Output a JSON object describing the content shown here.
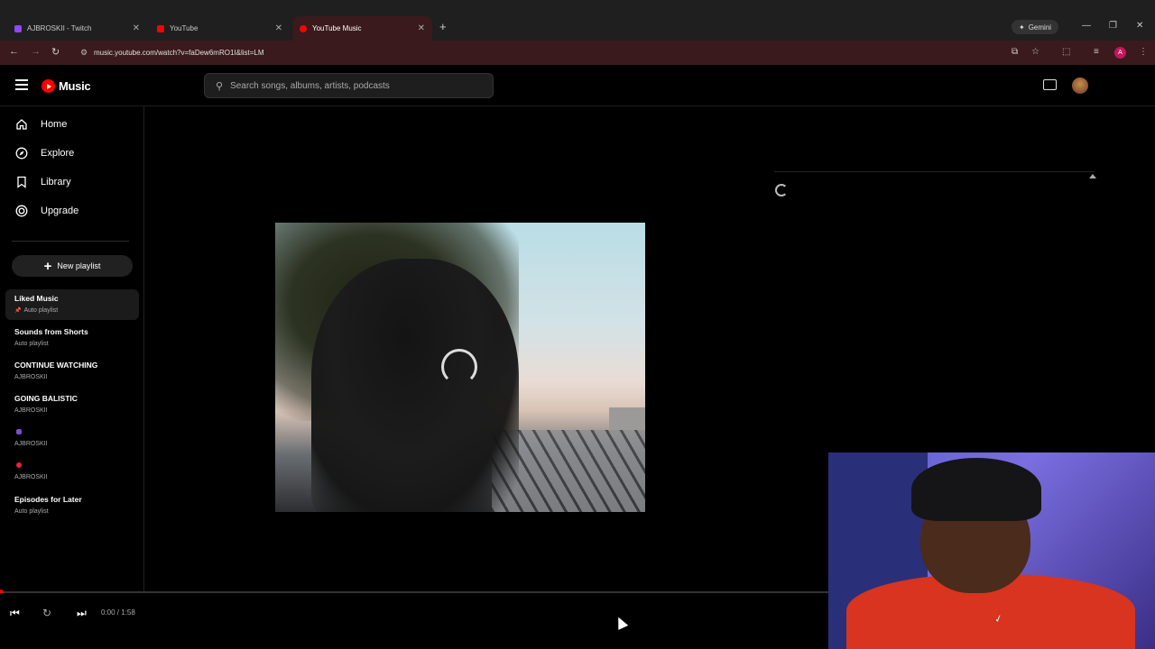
{
  "browser": {
    "tabs": [
      {
        "title": "AJBROSKII - Twitch",
        "favicon_color": "#9146ff"
      },
      {
        "title": "YouTube",
        "favicon_color": "#ff0000"
      },
      {
        "title": "YouTube Music",
        "favicon_color": "#ff0000"
      }
    ],
    "gemini_label": "Gemini",
    "url": "music.youtube.com/watch?v=faDew6mRO1I&list=LM",
    "profile_initial": "A"
  },
  "app": {
    "logo_text": "Music",
    "search_placeholder": "Search songs, albums, artists, podcasts",
    "accent": "#ff0000"
  },
  "sidebar": {
    "nav": [
      {
        "label": "Home",
        "icon": "home-icon"
      },
      {
        "label": "Explore",
        "icon": "compass-icon"
      },
      {
        "label": "Library",
        "icon": "bookmark-icon"
      },
      {
        "label": "Upgrade",
        "icon": "upgrade-icon"
      }
    ],
    "new_playlist_label": "New playlist",
    "playlists": [
      {
        "title": "Liked Music",
        "subtitle": "Auto playlist",
        "pinned": true
      },
      {
        "title": "Sounds from Shorts",
        "subtitle": "Auto playlist"
      },
      {
        "title": "CONTINUE WATCHING",
        "subtitle": "AJBROSKII"
      },
      {
        "title": "GOING BALISTIC",
        "subtitle": "AJBROSKII"
      },
      {
        "title": "",
        "subtitle": "AJBROSKII",
        "emoji_color": "#7b4fc9"
      },
      {
        "title": "",
        "subtitle": "AJBROSKII",
        "emoji_color": "#e8213f"
      },
      {
        "title": "Episodes for Later",
        "subtitle": "Auto playlist"
      }
    ]
  },
  "player": {
    "time": "0:00 / 1:58",
    "progress": 0.0
  }
}
